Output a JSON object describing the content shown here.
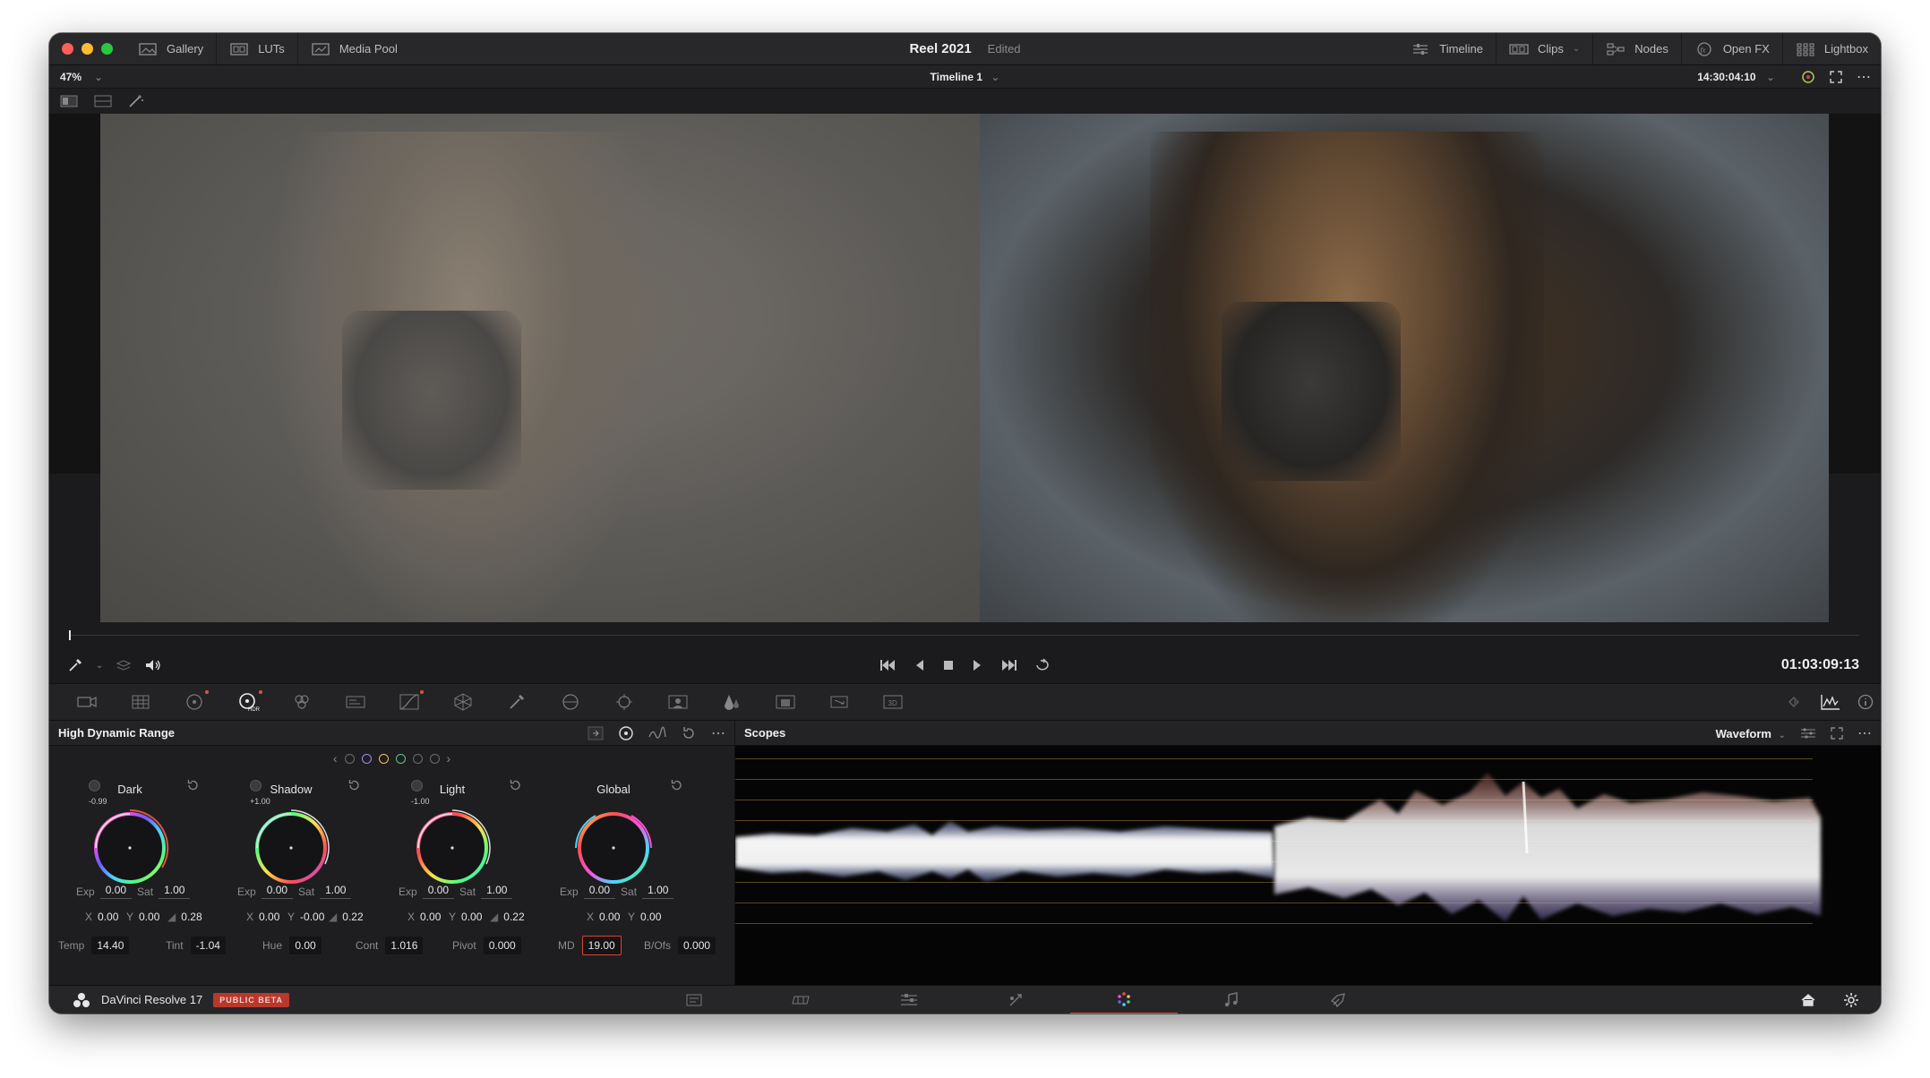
{
  "window": {
    "project_title": "Reel 2021",
    "status": "Edited",
    "traffic_colors": [
      "#ff5f57",
      "#febc2e",
      "#28c840"
    ]
  },
  "titlebar": {
    "left_buttons": [
      "Gallery",
      "LUTs",
      "Media Pool"
    ],
    "right_buttons": [
      "Timeline",
      "Clips",
      "Nodes",
      "Open FX",
      "Lightbox"
    ]
  },
  "viewer_bar": {
    "zoom": "47%",
    "timeline_name": "Timeline 1",
    "source_timecode": "14:30:04:10"
  },
  "transport": {
    "timecode": "01:03:09:13"
  },
  "hdr": {
    "panel_title": "High Dynamic Range",
    "wheels": [
      {
        "name": "Dark",
        "value": "-0.99",
        "exp": "0.00",
        "sat": "1.00",
        "x": "0.00",
        "y": "0.00",
        "falloff": "0.28"
      },
      {
        "name": "Shadow",
        "value": "+1.00",
        "exp": "0.00",
        "sat": "1.00",
        "x": "0.00",
        "y": "-0.00",
        "falloff": "0.22"
      },
      {
        "name": "Light",
        "value": "-1.00",
        "exp": "0.00",
        "sat": "1.00",
        "x": "0.00",
        "y": "0.00",
        "falloff": "0.22"
      },
      {
        "name": "Global",
        "value": "",
        "exp": "0.00",
        "sat": "1.00",
        "x": "0.00",
        "y": "0.00",
        "falloff": ""
      }
    ],
    "labels": {
      "exp": "Exp",
      "sat": "Sat",
      "x": "X",
      "y": "Y"
    },
    "global": {
      "temp_label": "Temp",
      "temp": "14.40",
      "tint_label": "Tint",
      "tint": "-1.04",
      "hue_label": "Hue",
      "hue": "0.00",
      "cont_label": "Cont",
      "cont": "1.016",
      "pivot_label": "Pivot",
      "pivot": "0.000",
      "md_label": "MD",
      "md": "19.00",
      "bofs_label": "B/Ofs",
      "bofs": "0.000"
    }
  },
  "scopes": {
    "title": "Scopes",
    "mode": "Waveform"
  },
  "footer": {
    "app_name": "DaVinci Resolve 17",
    "badge": "PUBLIC BETA",
    "accent": "#e0523d"
  }
}
